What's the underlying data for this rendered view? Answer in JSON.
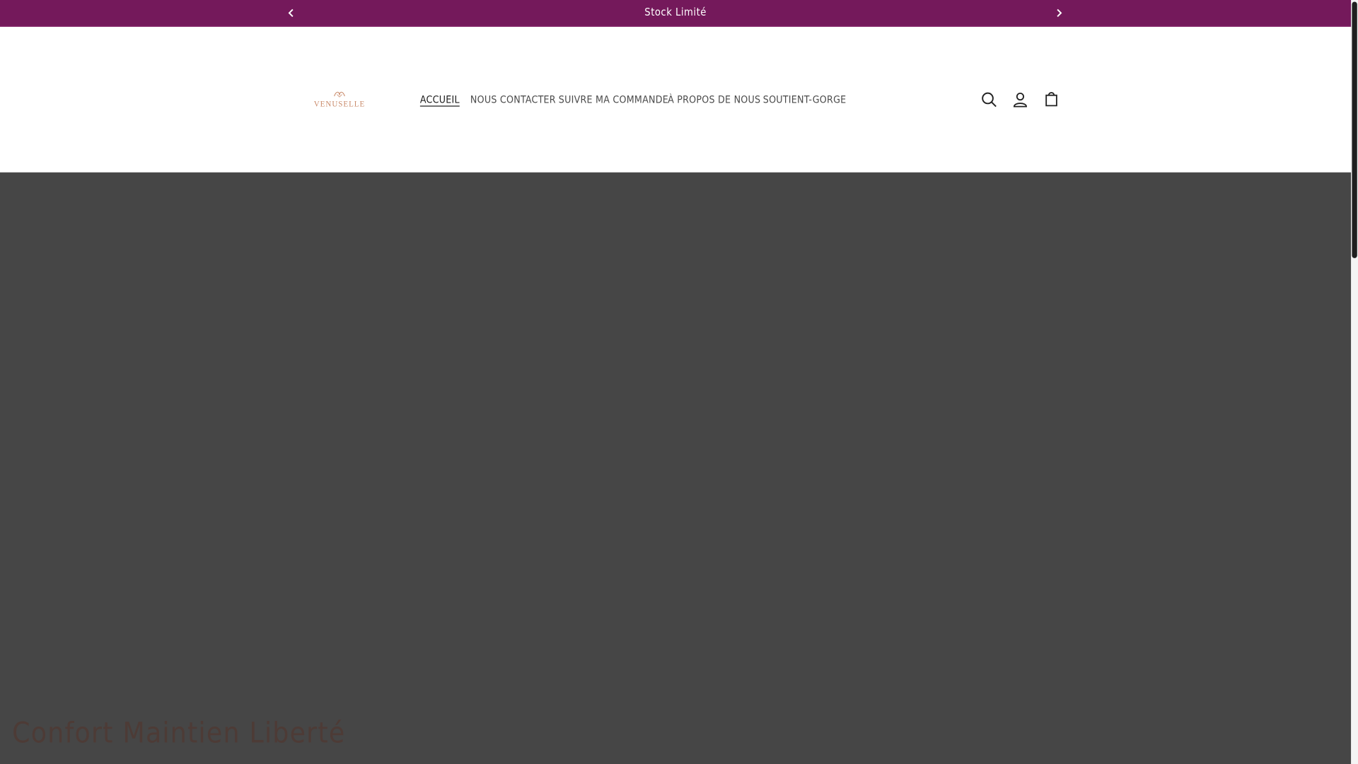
{
  "announcement": {
    "message": "Stock Limité",
    "prev_icon": "chevron-left-icon",
    "next_icon": "chevron-right-icon"
  },
  "header": {
    "logo_text": "VENUSELLE",
    "nav": [
      {
        "label": "ACCUEIL",
        "active": true
      },
      {
        "label": "NOUS CONTACTER",
        "active": false
      },
      {
        "label": "SUIVRE MA COMMANDE",
        "active": false
      },
      {
        "label": "À PROPOS DE NOUS",
        "active": false
      },
      {
        "label": "SOUTIENT-GORGE",
        "active": false
      }
    ],
    "icons": [
      "search-icon",
      "account-icon",
      "cart-icon"
    ]
  },
  "hero": {
    "title": "Confort Maintien Liberté"
  },
  "colors": {
    "announcement_bg": "#74195b",
    "hero_bg": "#464646",
    "logo_accent": "#c98a6a"
  }
}
